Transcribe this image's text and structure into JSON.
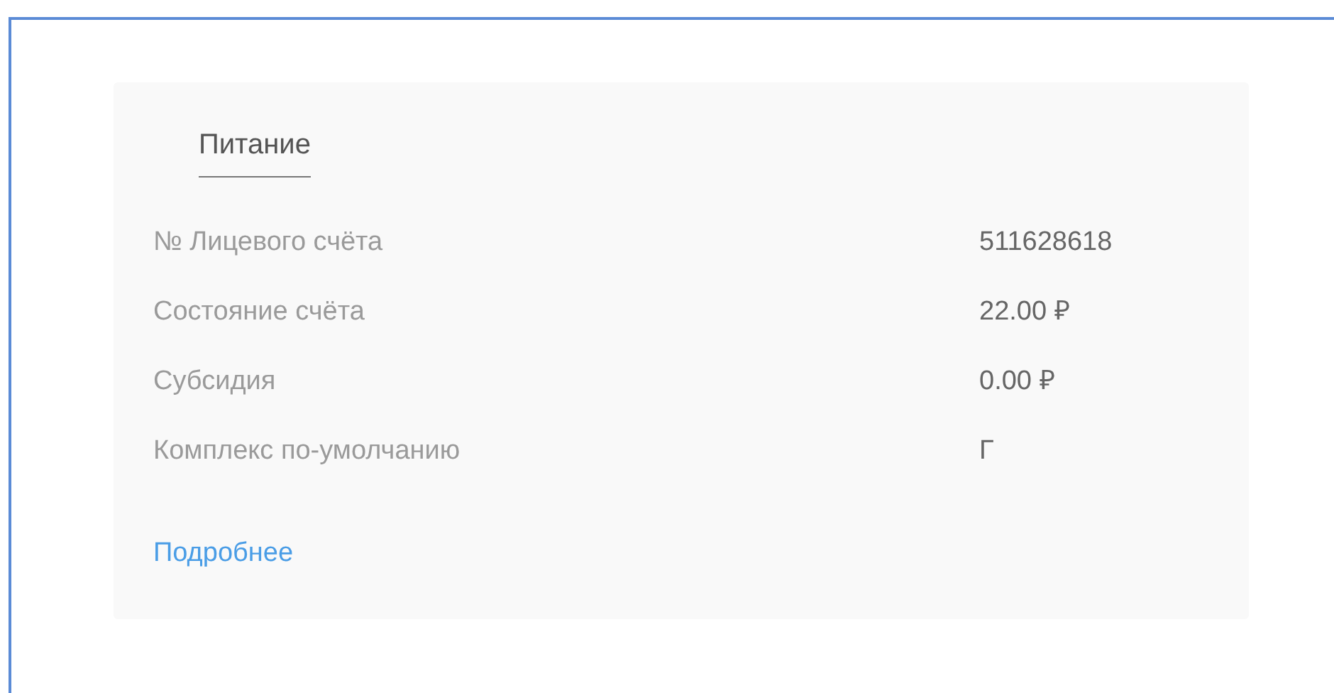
{
  "section": {
    "title": "Питание"
  },
  "rows": [
    {
      "label": "№ Лицевого счёта",
      "value": "511628618"
    },
    {
      "label": "Состояние счёта",
      "value": "22.00 ₽"
    },
    {
      "label": "Субсидия",
      "value": "0.00 ₽"
    },
    {
      "label": "Комплекс по-умолчанию",
      "value": "Г"
    }
  ],
  "link": "Подробнее"
}
